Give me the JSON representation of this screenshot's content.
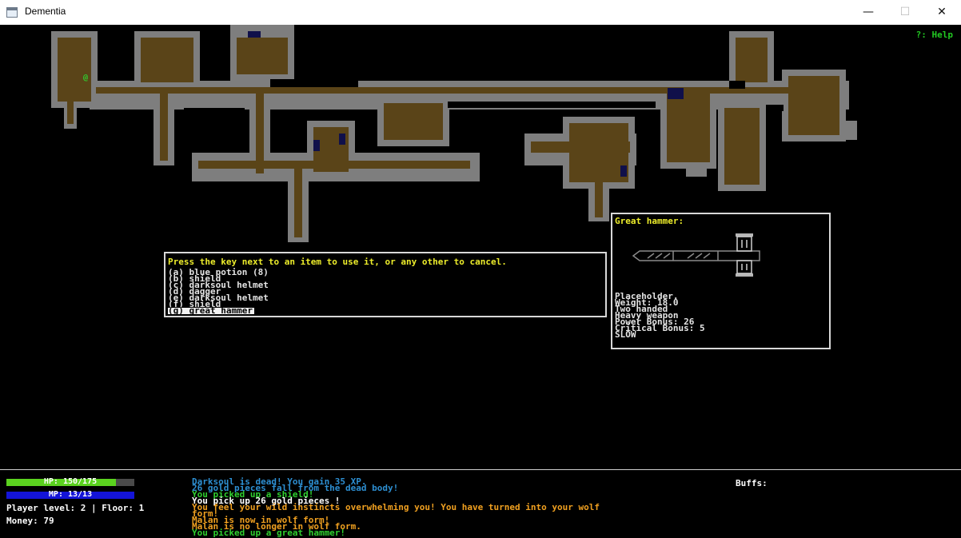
{
  "window": {
    "title": "Dementia",
    "minimize_glyph": "—",
    "maximize_glyph": "☐",
    "close_glyph": "✕"
  },
  "help_hint": "?: Help",
  "player_glyph": "@",
  "inventory": {
    "prompt": "Press the key next to an item to use it, or any other to cancel.",
    "items": [
      "(a) blue potion (8)",
      "(b) shield",
      "(c) darksoul helmet",
      "(d) dagger",
      "(e) darksoul helmet",
      "(f) shield",
      "(g) great hammer"
    ],
    "selected_index": 6
  },
  "item_detail": {
    "title": "Great hammer:",
    "icon": "great-hammer-icon",
    "lines": [
      "Placeholder.",
      "Weight: 18.0",
      "Two handed",
      "Heavy weapon",
      "Power Bonus: 26",
      "Critical Bonus: 5",
      "SLOW"
    ]
  },
  "status": {
    "hp_text": "HP: 150/175",
    "hp_current": 150,
    "hp_max": 175,
    "mp_text": "MP: 13/13",
    "mp_current": 13,
    "mp_max": 13,
    "level_floor": "Player level: 2 | Floor: 1",
    "money": "Money: 79"
  },
  "buffs_label": "Buffs:",
  "log": [
    {
      "text": "Darksoul is dead! You gain 35 XP.",
      "color": "#2d8fd2"
    },
    {
      "text": "26 gold pieces fall from the dead body!",
      "color": "#2d8fd2"
    },
    {
      "text": "You picked up a shield!",
      "color": "#2fd02f"
    },
    {
      "text": "You pick up 26 gold pieces !",
      "color": "#ffffff"
    },
    {
      "text": "You feel your wild instincts overwhelming you! You have turned into your wolf",
      "color": "#f0a020"
    },
    {
      "text": "form!",
      "color": "#f0a020"
    },
    {
      "text": "Malan is now in wolf form!",
      "color": "#f0a020"
    },
    {
      "text": "Malan is no longer in wolf form.",
      "color": "#f0a020"
    },
    {
      "text": "You picked up a great hammer!",
      "color": "#2fd02f"
    }
  ],
  "colors": {
    "floor": "#5a4418",
    "wall": "#7e7e7e",
    "door": "#10104a",
    "help": "#22c822",
    "prompt": "#eded2b"
  }
}
